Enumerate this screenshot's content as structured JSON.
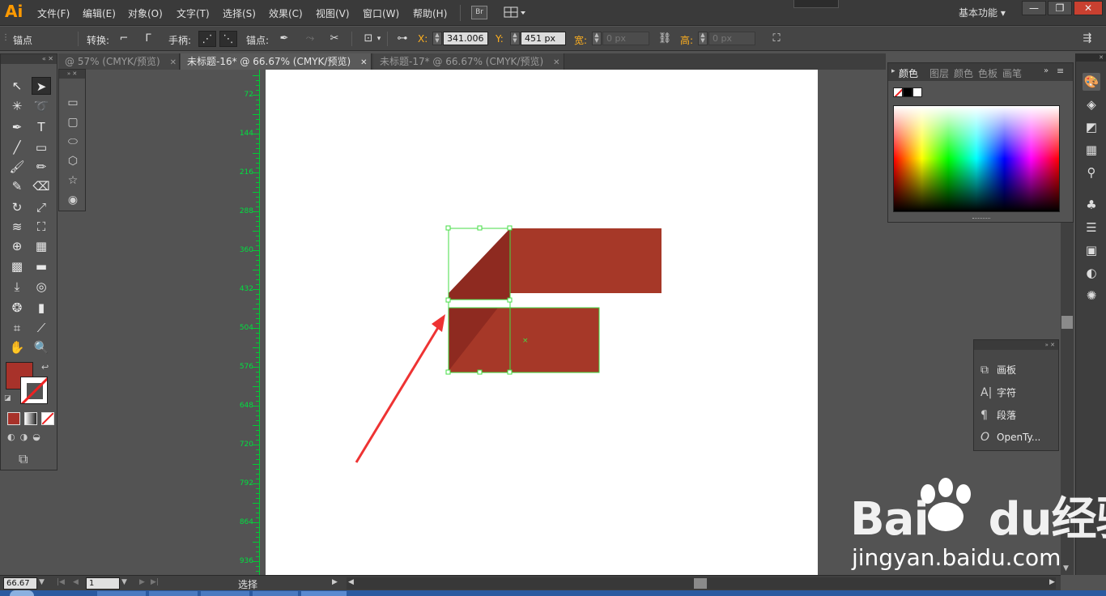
{
  "app": {
    "logo": "Ai"
  },
  "menu": [
    "文件(F)",
    "编辑(E)",
    "对象(O)",
    "文字(T)",
    "选择(S)",
    "效果(C)",
    "视图(V)",
    "窗口(W)",
    "帮助(H)"
  ],
  "bridge_button": "Br",
  "workspace": "基本功能",
  "window_controls": {
    "minimize": "—",
    "restore": "❐",
    "close": "✕"
  },
  "control_bar": {
    "mode_label": "锚点",
    "convert_label": "转换:",
    "handles_label": "手柄:",
    "anchors_label": "锚点:",
    "x_label": "X:",
    "x_value": "341.006",
    "y_label": "Y:",
    "y_value": "451 px",
    "w_label": "宽:",
    "w_value": "0 px",
    "h_label": "高:",
    "h_value": "0 px"
  },
  "tabs": [
    {
      "label": "@ 57% (CMYK/预览)",
      "active": false
    },
    {
      "label": "未标题-16* @ 66.67% (CMYK/预览)",
      "active": true
    },
    {
      "label": "未标题-17* @ 66.67% (CMYK/预览)",
      "active": false
    }
  ],
  "ruler_labels": [
    "72",
    "144",
    "216",
    "288",
    "360",
    "432",
    "504",
    "576",
    "648",
    "720",
    "792",
    "864",
    "936"
  ],
  "color_panel": {
    "tabs": [
      "颜色",
      "图层",
      "颜色",
      "色板",
      "画笔"
    ]
  },
  "small_panel": {
    "items": [
      {
        "icon": "artboard-icon",
        "label": "画板"
      },
      {
        "icon": "character-icon",
        "label": "字符"
      },
      {
        "icon": "paragraph-icon",
        "label": "段落"
      },
      {
        "icon": "opentype-icon",
        "label": "OpenTy..."
      }
    ]
  },
  "status_bar": {
    "zoom": "66.67",
    "artboard_number": "1",
    "tool_status": "选择"
  },
  "watermark": {
    "brand": "Bai",
    "brand_tail": "du",
    "cn": "经验",
    "url": "jingyan.baidu.com"
  },
  "colors": {
    "art_fill": "#a63828",
    "art_shade": "#8e2a20",
    "selection": "#44dd44",
    "arrow": "#ee3333"
  }
}
